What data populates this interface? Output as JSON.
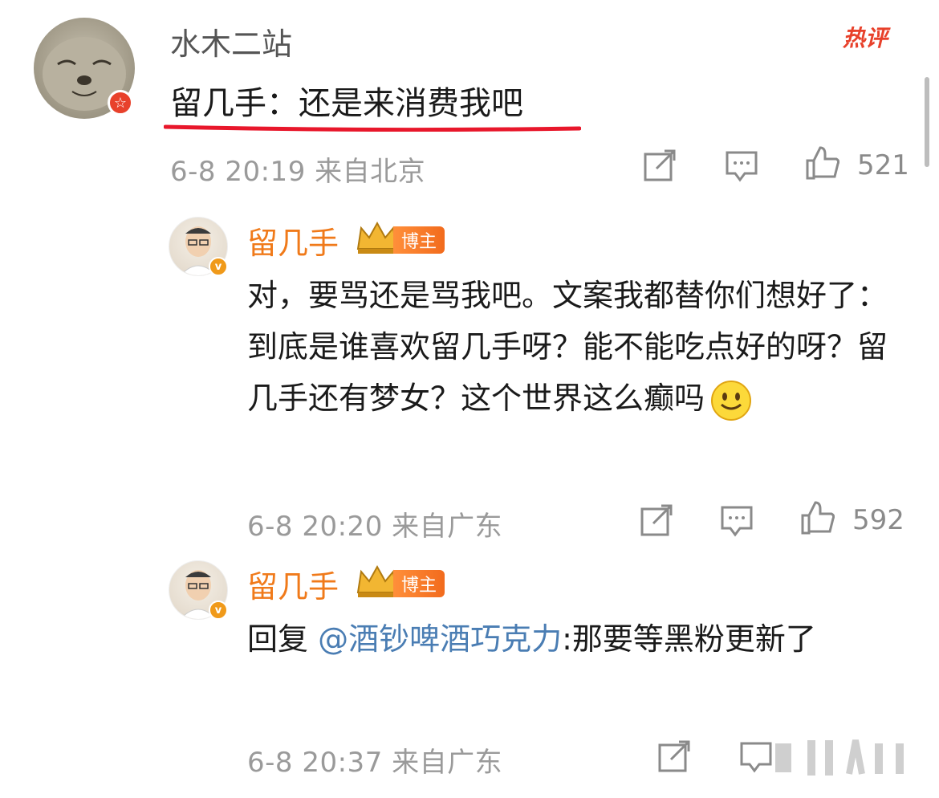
{
  "comment": {
    "username": "水木二站",
    "text": "留几手：还是来消费我吧",
    "time": "6-8 20:19",
    "location": "来自北京",
    "likes": "521",
    "hot_label": "热评"
  },
  "replies": [
    {
      "username": "留几手",
      "tag": "博主",
      "text": "对，要骂还是骂我吧。文案我都替你们想好了：到底是谁喜欢留几手呀？能不能吃点好的呀？留几手还有梦女？这个世界这么癫吗",
      "time": "6-8 20:20",
      "location": "来自广东",
      "likes": "592"
    },
    {
      "username": "留几手",
      "tag": "博主",
      "reply_prefix": "回复 ",
      "mention": "@酒钞啤酒巧克力",
      "text": ":那要等黑粉更新了",
      "time": "6-8 20:37",
      "location": "来自广东"
    }
  ],
  "colors": {
    "accent_orange": "#f07a1a",
    "hot_red": "#e8412b",
    "mention_blue": "#4a7db3",
    "meta_gray": "#9a9a9a"
  },
  "icons": [
    "share-icon",
    "comment-icon",
    "like-icon",
    "crown-icon",
    "smiley-emoji"
  ]
}
